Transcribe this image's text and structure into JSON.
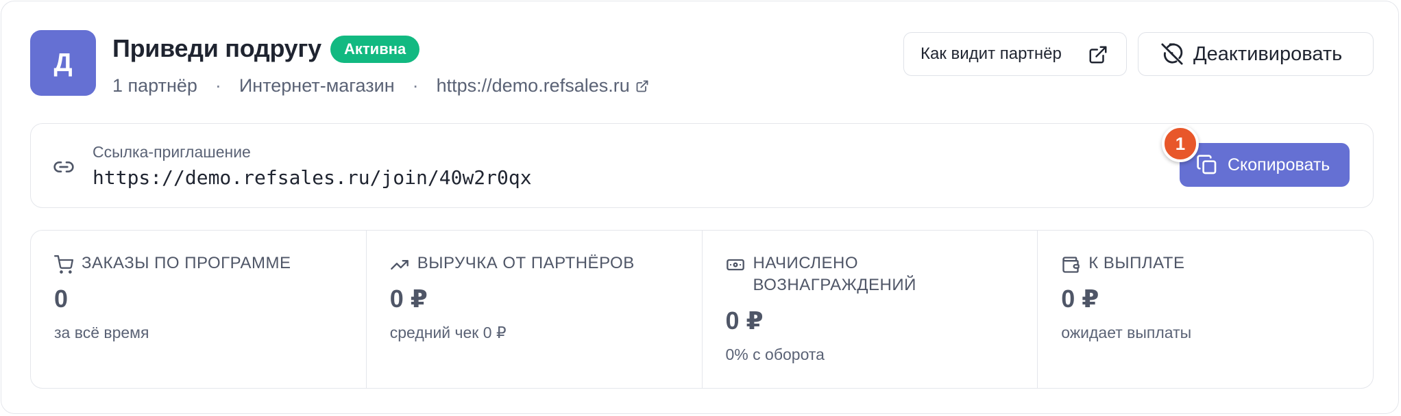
{
  "program": {
    "avatar_letter": "Д",
    "title": "Приведи подругу",
    "status": "Активна",
    "partners": "1 партнёр",
    "category": "Интернет-магазин",
    "site": "https://demo.refsales.ru",
    "separator": "·"
  },
  "actions": {
    "partner_view_label": "Как видит партнёр",
    "deactivate_label": "Деактивировать"
  },
  "invite": {
    "label": "Ссылка-приглашение",
    "url": "https://demo.refsales.ru/join/40w2r0qx",
    "copy_label": "Скопировать",
    "step": "1"
  },
  "stats": [
    {
      "icon": "cart-icon",
      "title": "Заказы по программе",
      "value": "0",
      "sub": "за всё время"
    },
    {
      "icon": "trend-up-icon",
      "title": "Выручка от партнёров",
      "value": "0 ₽",
      "sub": "средний чек 0 ₽"
    },
    {
      "icon": "banknote-icon",
      "title": "Начислено вознаграждений",
      "value": "0 ₽",
      "sub": "0% с оборота"
    },
    {
      "icon": "wallet-icon",
      "title": "К выплате",
      "value": "0 ₽",
      "sub": "ожидает выплаты"
    }
  ],
  "colors": {
    "accent": "#6570d3",
    "status_green": "#12b981",
    "step_orange": "#e8572a",
    "border": "#e4e6eb"
  }
}
